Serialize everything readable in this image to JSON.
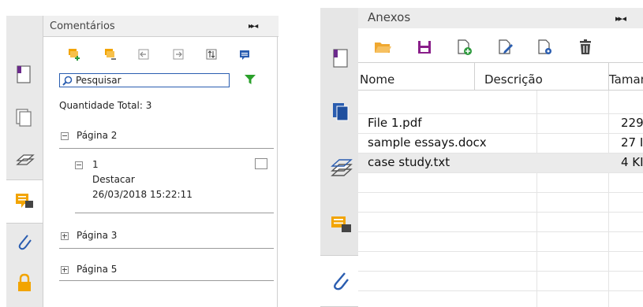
{
  "comments_panel": {
    "title": "Comentários",
    "header_controls": "▸▸ ◂",
    "search_placeholder": "Pesquisar",
    "total": "Quantidade Total: 3",
    "groups": [
      {
        "label": "Página 2",
        "expanded": true
      },
      {
        "label": "Página 3",
        "expanded": false
      },
      {
        "label": "Página 5",
        "expanded": false
      }
    ],
    "item": {
      "number": "1",
      "type": "Destacar",
      "date": "26/03/2018 15:22:11"
    },
    "colors": {
      "accent": "#f2a400",
      "filter": "#2aa02a",
      "search_border": "#2a5db0"
    }
  },
  "attachments_panel": {
    "title": "Anexos",
    "header_controls": "▸▸ ◂",
    "columns": [
      "Nome",
      "Descrição",
      "Taman"
    ],
    "rows": [
      {
        "name": "File 1.pdf",
        "size": "229"
      },
      {
        "name": "sample essays.docx",
        "size": "27 I"
      },
      {
        "name": "case study.txt",
        "size": "4 KI"
      }
    ],
    "colors": {
      "folder": "#f0a830",
      "save": "#8a1f8a",
      "green": "#2e9a3e",
      "blue": "#2a5db0"
    }
  }
}
